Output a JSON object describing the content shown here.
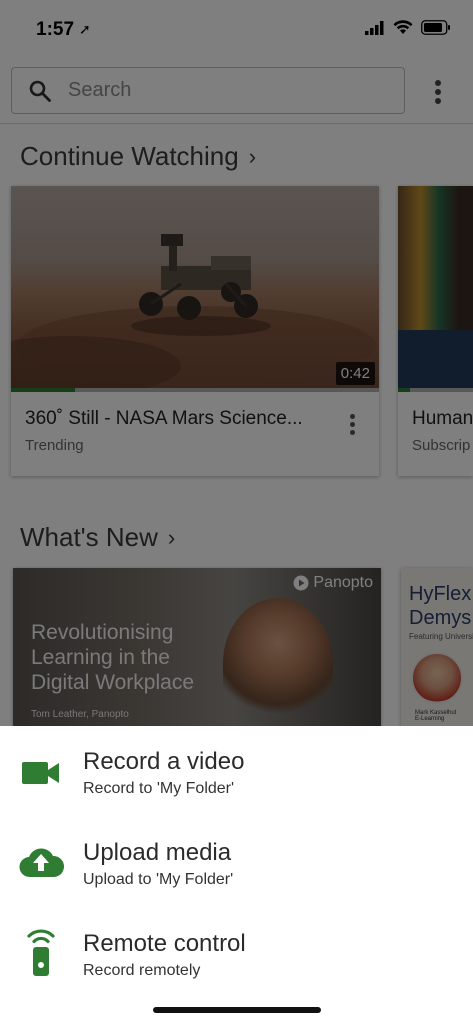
{
  "status_bar": {
    "time": "1:57",
    "location_icon": "location-arrow-icon"
  },
  "search": {
    "placeholder": "Search"
  },
  "continue_watching": {
    "title": "Continue Watching",
    "cards": [
      {
        "title": "360˚ Still - NASA Mars Science...",
        "subtitle": "Trending",
        "duration": "0:42",
        "progress": 0.175
      },
      {
        "title": "Human",
        "subtitle": "Subscrip"
      }
    ]
  },
  "whats_new": {
    "title": "What's New",
    "cards": [
      {
        "brand": "Panopto",
        "headline_lines": [
          "Revolutionising",
          "Learning in the",
          "Digital Workplace"
        ],
        "caption": "Tom Leather, Panopto"
      },
      {
        "headline_lines": [
          "HyFlex",
          "Demys"
        ],
        "small_text": "Featuring Universit",
        "person_name": "Mark Kasselhut",
        "person_org": "E-Learning"
      }
    ]
  },
  "action_sheet": {
    "items": [
      {
        "title": "Record a video",
        "subtitle": "Record to 'My Folder'",
        "icon": "video-camera-icon"
      },
      {
        "title": "Upload media",
        "subtitle": "Upload to 'My Folder'",
        "icon": "cloud-upload-icon"
      },
      {
        "title": "Remote control",
        "subtitle": "Record remotely",
        "icon": "remote-control-icon"
      }
    ]
  },
  "colors": {
    "accent": "#2e7d32",
    "overlay": "rgba(0,0,0,0.5)"
  }
}
